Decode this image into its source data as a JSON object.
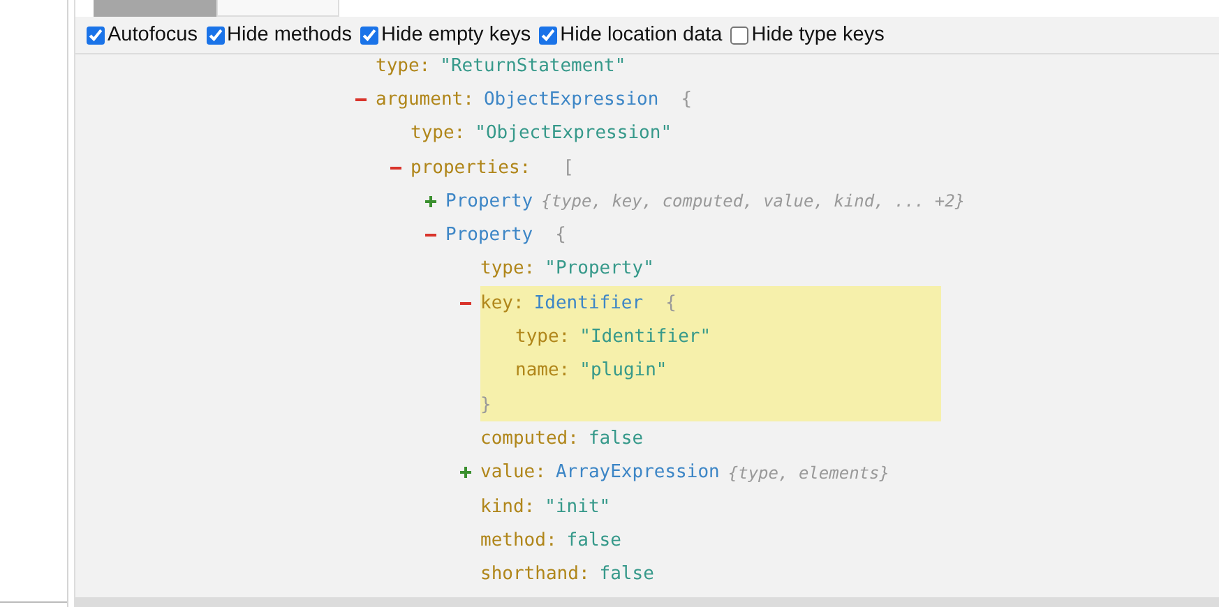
{
  "tabs": [
    {
      "selected": true
    },
    {
      "selected": false
    }
  ],
  "options": [
    {
      "label": "Autofocus",
      "checked": true
    },
    {
      "label": "Hide methods",
      "checked": true
    },
    {
      "label": "Hide empty keys",
      "checked": true
    },
    {
      "label": "Hide location data",
      "checked": true
    },
    {
      "label": "Hide type keys",
      "checked": false
    }
  ],
  "tree": [
    {
      "kind": "value",
      "key": "type:",
      "value": "\"ReturnStatement\""
    },
    {
      "kind": "node",
      "key": "argument:",
      "type_name": "ObjectExpression",
      "open": "{",
      "expanded": true,
      "children": [
        {
          "kind": "value",
          "key": "type:",
          "value": "\"ObjectExpression\""
        },
        {
          "kind": "node",
          "key": "properties:",
          "open": "[",
          "expanded": true,
          "children": [
            {
              "kind": "node",
              "type_name": "Property",
              "summary": "{type, key, computed, value, kind, ... +2}",
              "expanded": false
            },
            {
              "kind": "node",
              "type_name": "Property",
              "open": "{",
              "expanded": true,
              "children": [
                {
                  "kind": "value",
                  "key": "type:",
                  "value": "\"Property\""
                },
                {
                  "kind": "node",
                  "key": "key:",
                  "type_name": "Identifier",
                  "open": "{",
                  "expanded": true,
                  "highlighted": true,
                  "close": "}",
                  "children": [
                    {
                      "kind": "value",
                      "key": "type:",
                      "value": "\"Identifier\""
                    },
                    {
                      "kind": "value",
                      "key": "name:",
                      "value": "\"plugin\""
                    }
                  ]
                },
                {
                  "kind": "value",
                  "key": "computed:",
                  "value": "false"
                },
                {
                  "kind": "node",
                  "key": "value:",
                  "type_name": "ArrayExpression",
                  "summary": "{type, elements}",
                  "expanded": false
                },
                {
                  "kind": "value",
                  "key": "kind:",
                  "value": "\"init\""
                },
                {
                  "kind": "value",
                  "key": "method:",
                  "value": "false"
                },
                {
                  "kind": "value",
                  "key": "shorthand:",
                  "value": "false"
                }
              ]
            }
          ]
        }
      ]
    }
  ]
}
